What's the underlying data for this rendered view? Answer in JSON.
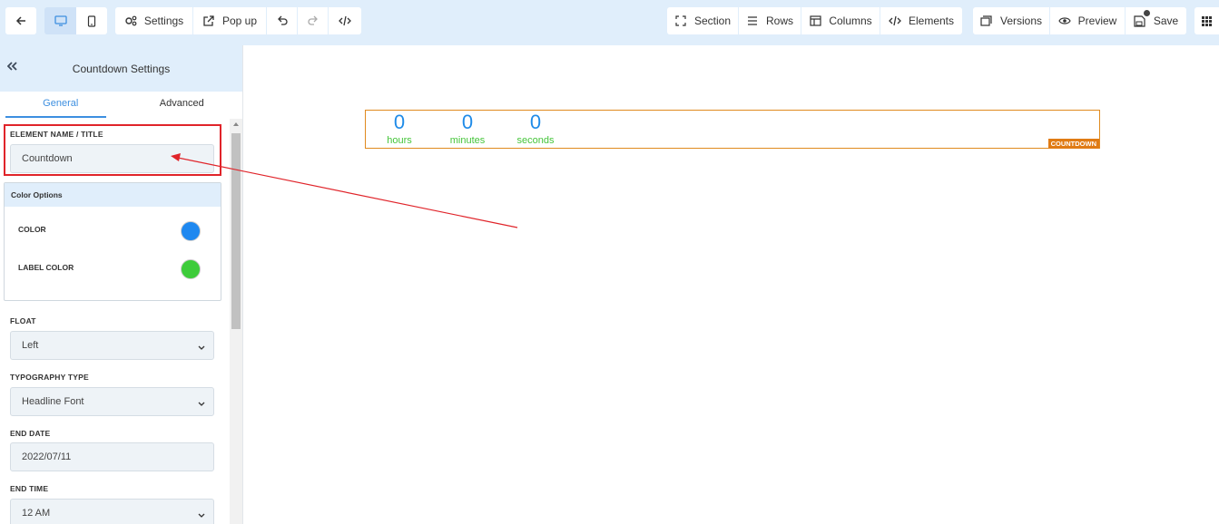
{
  "toolbar": {
    "settings_label": "Settings",
    "popup_label": "Pop up",
    "section_label": "Section",
    "rows_label": "Rows",
    "columns_label": "Columns",
    "elements_label": "Elements",
    "versions_label": "Versions",
    "preview_label": "Preview",
    "save_label": "Save"
  },
  "panel": {
    "title": "Countdown Settings",
    "tabs": [
      {
        "label": "General",
        "active": true
      },
      {
        "label": "Advanced",
        "active": false
      }
    ],
    "element_name_label": "ELEMENT NAME / TITLE",
    "element_name_value": "Countdown",
    "color_options": {
      "header": "Color Options",
      "color_label": "COLOR",
      "color_value": "#1e88f0",
      "label_color_label": "LABEL COLOR",
      "label_color_value": "#3dcc3a"
    },
    "float_label": "FLOAT",
    "float_value": "Left",
    "typography_label": "TYPOGRAPHY TYPE",
    "typography_value": "Headline Font",
    "end_date_label": "END DATE",
    "end_date_value": "2022/07/11",
    "end_time_label": "END TIME",
    "end_time_value": "12 AM"
  },
  "countdown": {
    "units": [
      {
        "value": "0",
        "label": "hours"
      },
      {
        "value": "0",
        "label": "minutes"
      },
      {
        "value": "0",
        "label": "seconds"
      }
    ],
    "badge": "COUNTDOWN"
  },
  "colors": {
    "accent": "#3d8fe0",
    "highlight": "#e0242a",
    "countdown_border": "#e08a1e"
  }
}
